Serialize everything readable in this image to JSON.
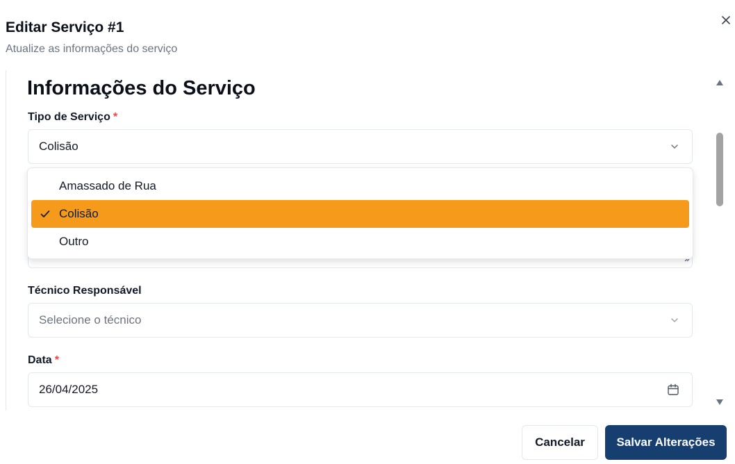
{
  "dialog": {
    "title": "Editar Serviço #1",
    "subtitle": "Atualize as informações do serviço",
    "close_icon": "close-icon"
  },
  "form": {
    "section_title": "Informações do Serviço",
    "required_mark": "*",
    "service_type": {
      "label": "Tipo de Serviço",
      "value": "Colisão",
      "icon": "chevron-down-icon"
    },
    "service_type_options": [
      {
        "label": "Amassado de Rua",
        "selected": false
      },
      {
        "label": "Colisão",
        "selected": true
      },
      {
        "label": "Outro",
        "selected": false
      }
    ],
    "technician": {
      "label": "Técnico Responsável",
      "placeholder": "Selecione o técnico",
      "icon": "chevron-down-icon"
    },
    "date": {
      "label": "Data",
      "value": "26/04/2025",
      "icon": "calendar-icon"
    }
  },
  "footer": {
    "cancel_label": "Cancelar",
    "save_label": "Salvar Alterações"
  },
  "colors": {
    "selected_option_bg": "#f59a1b",
    "primary_button_bg": "#163f6f",
    "required_mark": "#ef4444"
  }
}
